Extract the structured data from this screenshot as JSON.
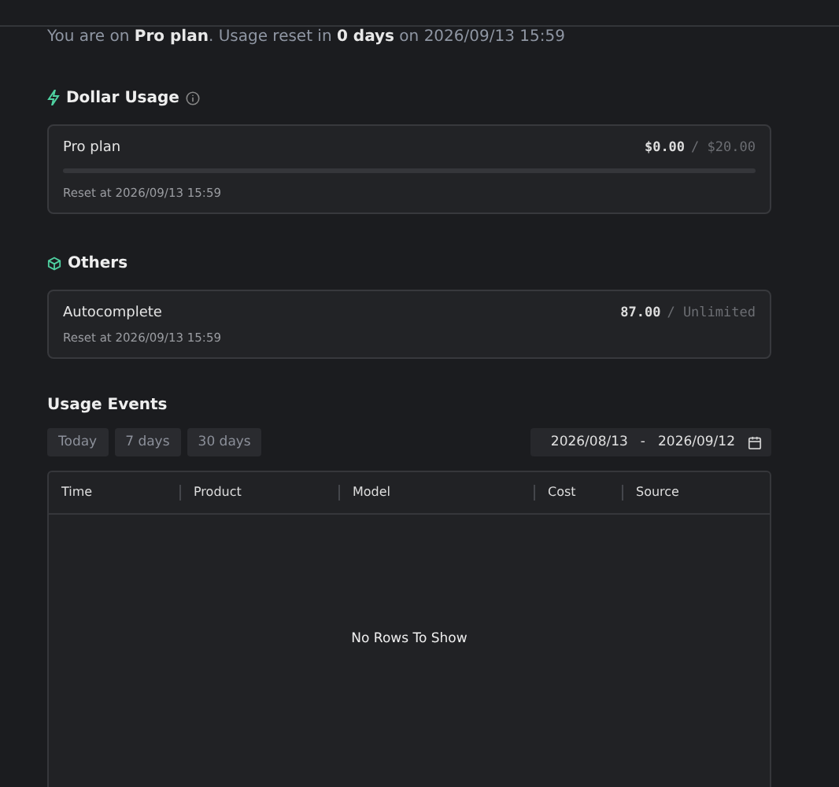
{
  "intro": "You are on **Pro plan**. Usage reset in **0 days** on 2026/09/13 15:59",
  "dollar_usage": {
    "title": "Dollar Usage",
    "items": [
      {
        "name": "Pro plan",
        "used": "$0.00",
        "limit": "/ $20.00",
        "level": 0,
        "reset": "Reset at 2026/09/13 15:59"
      }
    ]
  },
  "others": {
    "title": "Others",
    "items": [
      {
        "name": "Autocomplete",
        "used": "87.00",
        "limit": "/ Unlimited",
        "reset": "Reset at 2026/09/13 15:59"
      }
    ]
  },
  "usage_events": {
    "title": "Usage Events",
    "ranges": [
      {
        "label": "Today",
        "selected": false
      },
      {
        "label": "7 days",
        "selected": false
      },
      {
        "label": "30 days",
        "selected": false
      }
    ],
    "date_from": "2026/08/13",
    "date_sep": "-",
    "date_to": "2026/09/12",
    "table": {
      "columns": [
        "Time",
        "Product",
        "Model",
        "Cost",
        "Source"
      ],
      "empty": "No Rows To Show"
    }
  }
}
